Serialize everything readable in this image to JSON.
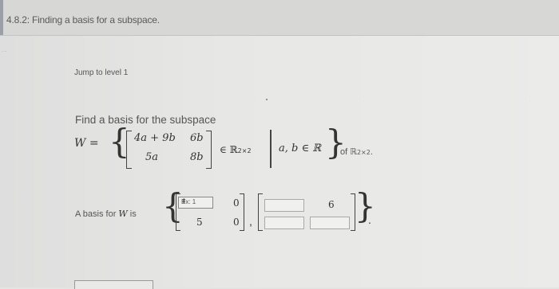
{
  "header": {
    "title": "4.8.2: Finding a basis for a subspace."
  },
  "sidebar": {
    "faint_label": "..."
  },
  "jump": {
    "label": "Jump to level 1"
  },
  "problem": {
    "prompt": "Find a basis for the subspace",
    "w_eq": "W =",
    "m11": "4a + 9b",
    "m12": "6b",
    "m21": "5a",
    "m22": "8b",
    "in_r": "∈ ℝ",
    "sub_2x2": "2×2",
    "cond": "a, b ∈ ℝ",
    "of_r": "of ℝ",
    "period": "."
  },
  "answer": {
    "label": "A basis for",
    "label_w": "W",
    "label_is": "is",
    "select_value": "Ex: 1",
    "select_arrow": "⬍",
    "b1_r1c2": "0",
    "b1_r2c1": "5",
    "b1_r2c2": "0",
    "b2_r1c2": "6",
    "comma": ",",
    "period": "."
  }
}
